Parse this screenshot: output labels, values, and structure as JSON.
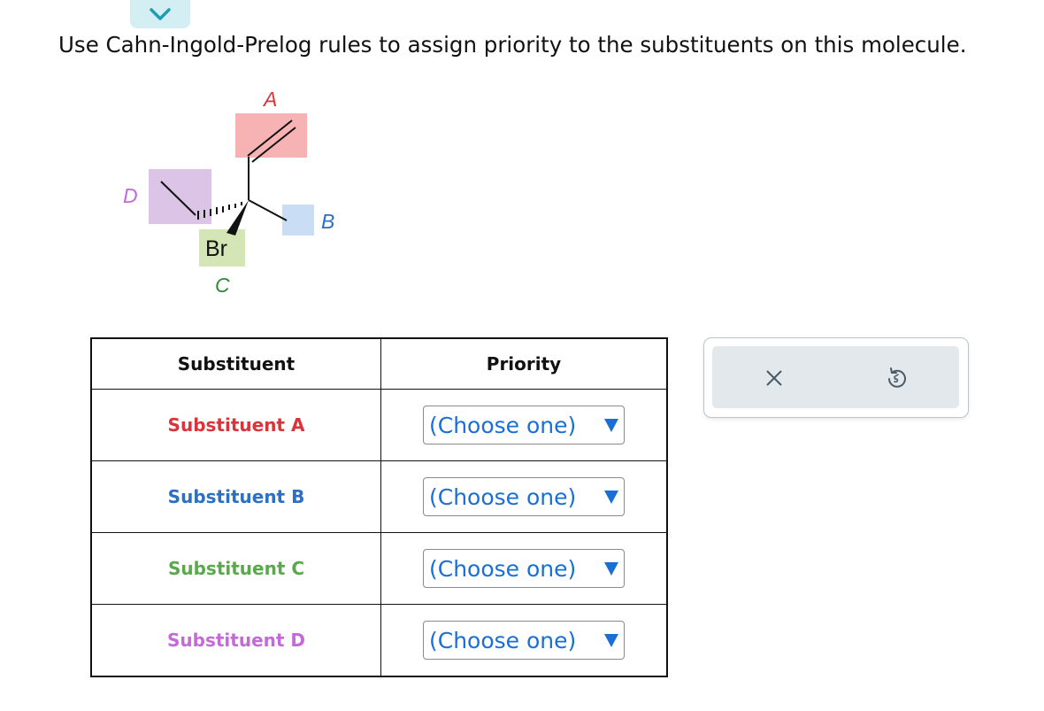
{
  "instructions": "Use Cahn-Ingold-Prelog rules to assign priority to the substituents on this molecule.",
  "molecule": {
    "labels": {
      "A": "A",
      "B": "B",
      "C": "C",
      "D": "D"
    },
    "bromine": "Br",
    "colors": {
      "A_box": "#f7b3b3",
      "A_text": "#d9343a",
      "B_box": "#c9def4",
      "B_text": "#2d6fc1",
      "C_box": "#d4e6b5",
      "C_text": "#2f8a3a",
      "D_box": "#dcc4e6",
      "D_text": "#c46ad8"
    }
  },
  "table": {
    "headers": {
      "substituent": "Substituent",
      "priority": "Priority"
    },
    "rows": [
      {
        "label": "Substituent A",
        "color": "#d9343a",
        "priority": "(Choose one)"
      },
      {
        "label": "Substituent B",
        "color": "#2d6fc1",
        "priority": "(Choose one)"
      },
      {
        "label": "Substituent C",
        "color": "#5aa84c",
        "priority": "(Choose one)"
      },
      {
        "label": "Substituent D",
        "color": "#c46ad8",
        "priority": "(Choose one)"
      }
    ]
  },
  "toolbar": {
    "clear_icon": "close-icon",
    "undo_icon": "undo-icon"
  },
  "header": {
    "collapse_icon": "chevron-down-icon"
  }
}
